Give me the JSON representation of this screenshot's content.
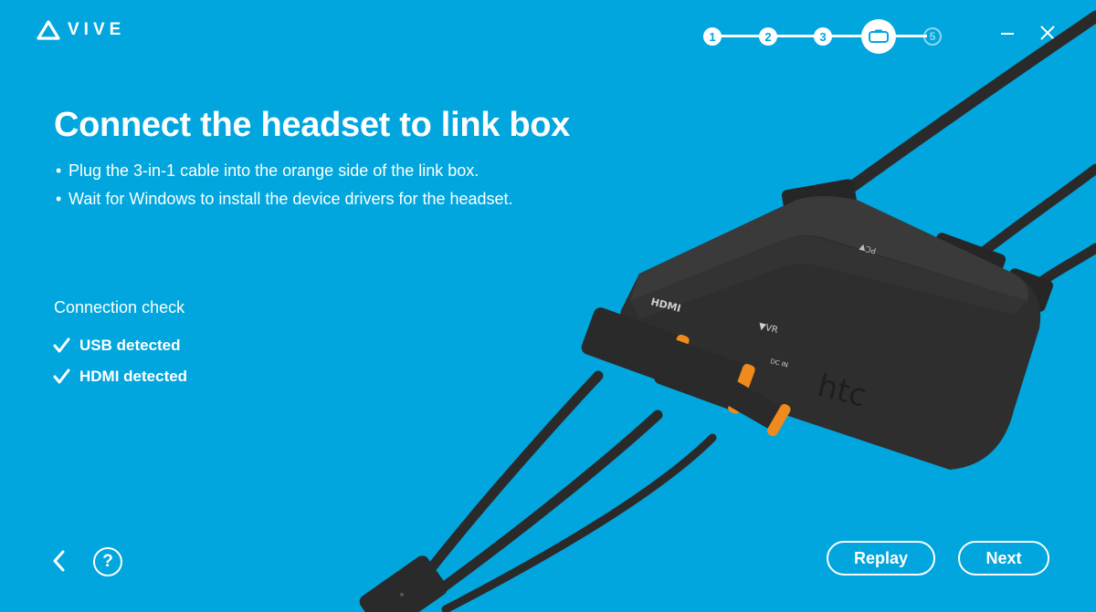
{
  "app": {
    "logo_text": "VIVE",
    "logo_icon": "vive-logo-icon"
  },
  "stepper": {
    "steps": [
      "1",
      "2",
      "3",
      "",
      "5"
    ],
    "current_step_index": 3,
    "current_step_icon": "headset-icon"
  },
  "window": {
    "minimize_icon": "minimize-icon",
    "close_icon": "close-icon"
  },
  "main": {
    "title": "Connect the headset to link box",
    "bullets": [
      "Plug the 3-in-1 cable into the orange side of the link box.",
      "Wait for Windows to install the device drivers for the headset."
    ]
  },
  "connection_check": {
    "title": "Connection check",
    "items": [
      {
        "label": "USB detected",
        "icon": "checkmark-icon"
      },
      {
        "label": "HDMI detected",
        "icon": "checkmark-icon"
      }
    ]
  },
  "illustration": {
    "brand": "htc",
    "port_labels": [
      "HDMI",
      "VR",
      "DC IN",
      "PC"
    ]
  },
  "footer": {
    "back_icon": "chevron-left-icon",
    "help_label": "?",
    "replay_label": "Replay",
    "next_label": "Next"
  },
  "colors": {
    "background": "#00a6dd",
    "accent_orange": "#f08a1c",
    "device_dark": "#2b2b2b",
    "text": "#ffffff"
  }
}
